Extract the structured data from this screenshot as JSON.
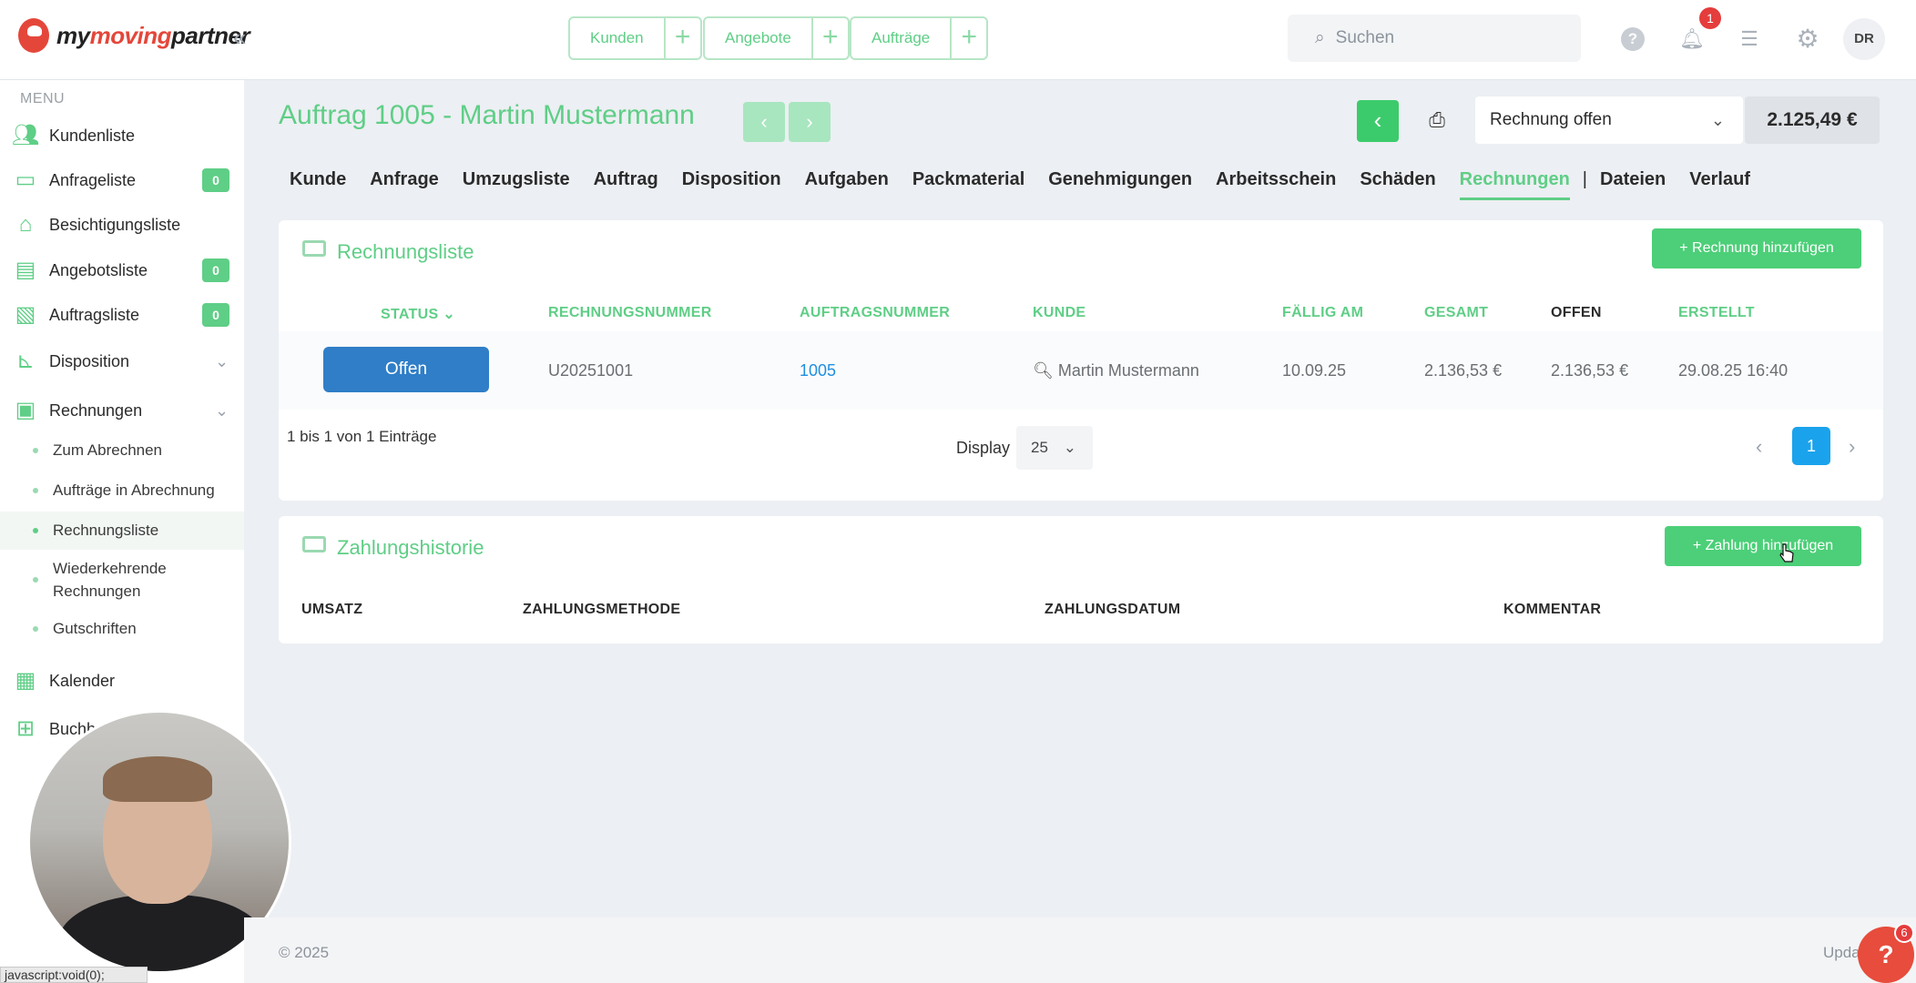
{
  "brand": {
    "name_part1": "my",
    "name_part2": "moving",
    "name_part3": "partner"
  },
  "topbar": {
    "quick_actions": [
      {
        "label": "Kunden"
      },
      {
        "label": "Angebote"
      },
      {
        "label": "Aufträge"
      }
    ],
    "search_placeholder": "Suchen",
    "notification_count": "1",
    "user_initials": "DR"
  },
  "sidebar": {
    "menu_label": "MENU",
    "items": [
      {
        "label": "Kundenliste"
      },
      {
        "label": "Anfrageliste",
        "badge": "0"
      },
      {
        "label": "Besichtigungsliste"
      },
      {
        "label": "Angebotsliste",
        "badge": "0"
      },
      {
        "label": "Auftragsliste",
        "badge": "0"
      },
      {
        "label": "Disposition"
      },
      {
        "label": "Rechnungen"
      },
      {
        "label": "Kalender"
      },
      {
        "label": "Buchh"
      }
    ],
    "sub_items": [
      {
        "label": "Zum Abrechnen"
      },
      {
        "label": "Aufträge in Abrechnung"
      },
      {
        "label": "Rechnungsliste"
      },
      {
        "label": "Wiederkehrende Rechnungen"
      },
      {
        "label": "Gutschriften"
      }
    ]
  },
  "page": {
    "title": "Auftrag 1005 - Martin Mustermann",
    "status_select": "Rechnung offen",
    "amount": "2.125,49 €",
    "tabs": [
      "Kunde",
      "Anfrage",
      "Umzugsliste",
      "Auftrag",
      "Disposition",
      "Aufgaben",
      "Packmaterial",
      "Genehmigungen",
      "Arbeitsschein",
      "Schäden",
      "Rechnungen",
      "|",
      "Dateien",
      "Verlauf"
    ],
    "active_tab": "Rechnungen"
  },
  "invoices": {
    "title": "Rechnungsliste",
    "add_button": "+ Rechnung hinzufügen",
    "columns": [
      "STATUS",
      "RECHNUNGSNUMMER",
      "AUFTRAGSNUMMER",
      "KUNDE",
      "FÄLLIG AM",
      "GESAMT",
      "OFFEN",
      "ERSTELLT"
    ],
    "rows": [
      {
        "status": "Offen",
        "rechnungsnummer": "U20251001",
        "auftragsnummer": "1005",
        "kunde": "Martin Mustermann",
        "faellig": "10.09.25",
        "gesamt": "2.136,53 €",
        "offen": "2.136,53 €",
        "erstellt": "29.08.25 16:40"
      }
    ],
    "pager_info": "1 bis 1 von 1 Einträge",
    "display_label": "Display",
    "display_value": "25",
    "current_page": "1"
  },
  "payments": {
    "title": "Zahlungshistorie",
    "add_button": "+ Zahlung hinzufügen",
    "columns": [
      "UMSATZ",
      "ZAHLUNGSMETHODE",
      "ZAHLUNGSDATUM",
      "KOMMENTAR"
    ]
  },
  "footer": {
    "copyright": "© 2025",
    "right_text": "Upda"
  },
  "help_fab": {
    "label": "?",
    "count": "6"
  },
  "browser_status": "javascript:void(0);",
  "colors": {
    "accent": "#5fce86",
    "primary_blue": "#2f7ec7",
    "link": "#1f8fe0",
    "danger": "#e53c3c"
  }
}
